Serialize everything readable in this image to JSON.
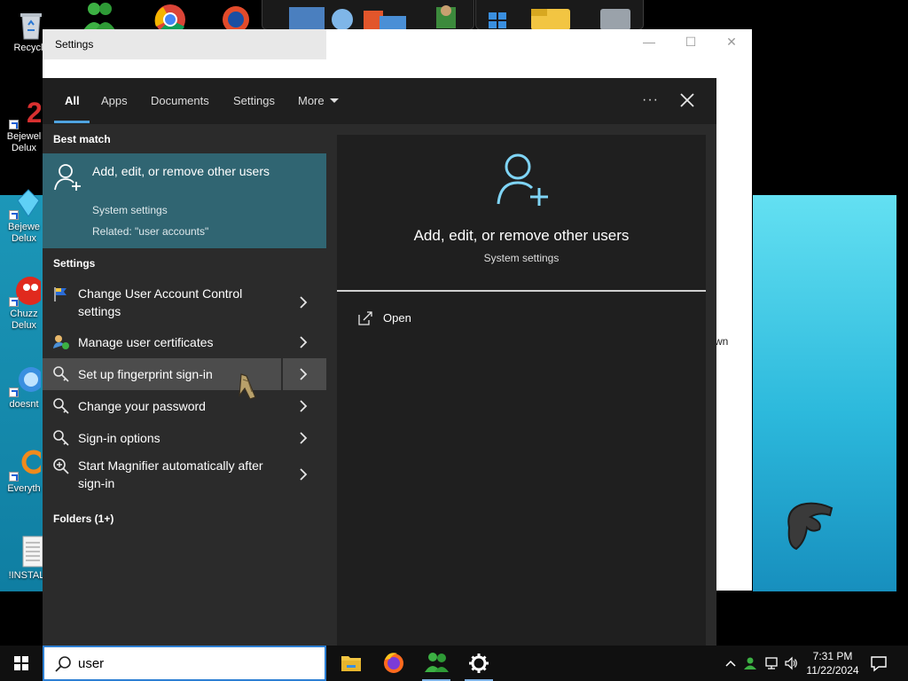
{
  "desktop": {
    "icons": [
      {
        "label": "Recycle",
        "name": "recycle-bin"
      },
      {
        "label": "Bejewel Delux",
        "name": "bejeweled-2"
      },
      {
        "label": "Bejewe Delux",
        "name": "bejeweled-3"
      },
      {
        "label": "Chuzz Delux",
        "name": "chuzzle"
      },
      {
        "label": "doesnt",
        "name": "doesnt"
      },
      {
        "label": "Everyth",
        "name": "everything"
      },
      {
        "label": "!INSTALL",
        "name": "install"
      }
    ]
  },
  "settings_window": {
    "title": "Settings",
    "minimize_glyph": "—",
    "maximize_glyph": "☐",
    "close_glyph": "✕",
    "partial_text": "wn"
  },
  "search": {
    "tabs": [
      {
        "label": "All",
        "active": true
      },
      {
        "label": "Apps",
        "active": false
      },
      {
        "label": "Documents",
        "active": false
      },
      {
        "label": "Settings",
        "active": false
      },
      {
        "label": "More",
        "active": false
      }
    ],
    "more_options": "···",
    "best_match_header": "Best match",
    "best_match": {
      "title": "Add, edit, or remove other users",
      "subtitle": "System settings",
      "related": "Related: \"user accounts\"",
      "icon": "add-user-icon"
    },
    "settings_header": "Settings",
    "results": [
      {
        "label": "Change User Account Control settings",
        "icon": "uac-flag-icon"
      },
      {
        "label": "Manage user certificates",
        "icon": "certificate-icon"
      },
      {
        "label": "Set up fingerprint sign-in",
        "icon": "key-icon"
      },
      {
        "label": "Change your password",
        "icon": "key-icon"
      },
      {
        "label": "Sign-in options",
        "icon": "key-icon"
      },
      {
        "label": "Start Magnifier automatically after sign-in",
        "icon": "magnifier-icon"
      }
    ],
    "folders_header": "Folders (1+)",
    "preview": {
      "title": "Add, edit, or remove other users",
      "subtitle": "System settings",
      "action_open": "Open"
    },
    "query": "user"
  },
  "taskbar": {
    "apps": [
      "file-explorer",
      "firefox",
      "users",
      "settings"
    ],
    "clock_time": "7:31 PM",
    "clock_date": "11/22/2024"
  },
  "colors": {
    "accent": "#4fa3e0",
    "best_match_bg": "#306572",
    "panel_bg": "#2b2b2b",
    "preview_bg": "#1f1f1f",
    "icon_accent": "#7fd4f5"
  }
}
